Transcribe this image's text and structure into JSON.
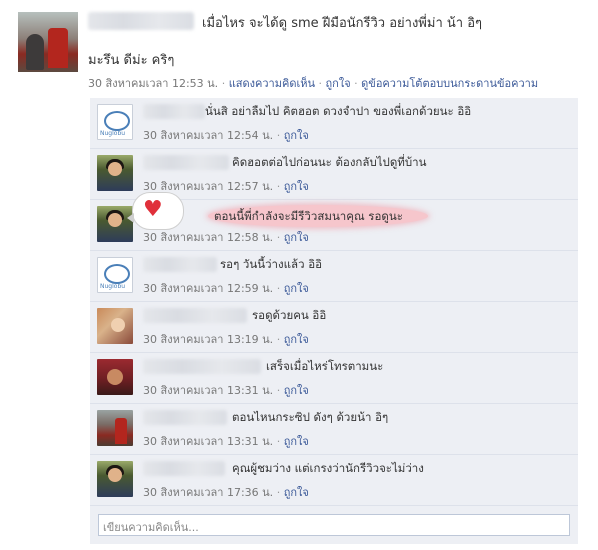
{
  "post": {
    "line1": "เมื่อไหร จะได้ดู sme ฝีมือนักรีวิว อย่างพี่ม่า น้า อิๆ",
    "line2": "มะรึน ดีม่ะ คริๆ",
    "time": "30 สิงหาคมเวลา 12:53 น.",
    "show_comments": "แสดงความคิดเห็น",
    "like": "ถูกใจ",
    "see_wall": "ดูข้อความโต้ตอบบนกระดานข้อความ",
    "sep": "·"
  },
  "comments": [
    {
      "text": "นั่นสิ อย่าลืมไป คิตฮอต ดวงจำปา ของพี่เอกด้วยนะ อิอิ",
      "time": "30 สิงหาคมเวลา 12:54 น.",
      "like": "ถูกใจ",
      "avatar_label": "Nuglobu"
    },
    {
      "text": "คิดฮอตต่อไปก่อนนะ ต้องกลับไปดูที่บ้าน",
      "time": "30 สิงหาคมเวลา 12:57 น.",
      "like": "ถูกใจ"
    },
    {
      "text": "ตอนนี้พี่กำลังจะมีรีวิวสมนาคุณ รอดูนะ",
      "time": "30 สิงหาคมเวลา 12:58 น.",
      "like": "ถูกใจ"
    },
    {
      "text": "รอๆ วันนี้ว่างแล้ว อิอิ",
      "time": "30 สิงหาคมเวลา 12:59 น.",
      "like": "ถูกใจ",
      "avatar_label": "Nuglobu"
    },
    {
      "text": "รอดูด้วยคน อิอิ",
      "time": "30 สิงหาคมเวลา 13:19 น.",
      "like": "ถูกใจ"
    },
    {
      "text": "เสร็จเมื่อไหร่โทรตามนะ",
      "time": "30 สิงหาคมเวลา 13:31 น.",
      "like": "ถูกใจ"
    },
    {
      "text": "ตอนไหนกระซิป ดังๆ ด้วยน้า อิๆ",
      "time": "30 สิงหาคมเวลา 13:31 น.",
      "like": "ถูกใจ"
    },
    {
      "text": "คุณผู้ชมว่าง แต่เกรงว่านักรีวิวจะไม่ว่าง",
      "time": "30 สิงหาคมเวลา 17:36 น.",
      "like": "ถูกใจ"
    }
  ],
  "comment_box": {
    "placeholder": "เขียนความคิดเห็น..."
  },
  "colors": {
    "link": "#3b5998",
    "comment_bg": "#edeff4",
    "highlight": "#f6c6cc",
    "heart": "#e0303a"
  }
}
